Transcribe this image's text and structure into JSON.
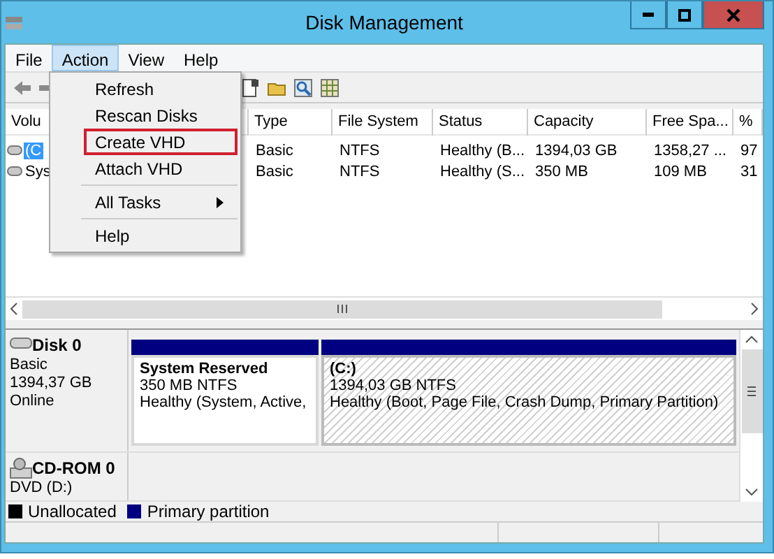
{
  "window": {
    "title": "Disk Management"
  },
  "menubar": [
    {
      "label": "File",
      "selected": false
    },
    {
      "label": "Action",
      "selected": true
    },
    {
      "label": "View",
      "selected": false
    },
    {
      "label": "Help",
      "selected": false
    }
  ],
  "menu": [
    {
      "kind": "item",
      "label": "Refresh",
      "outlined": false
    },
    {
      "kind": "item",
      "label": "Rescan Disks",
      "outlined": false
    },
    {
      "kind": "item",
      "label": "Create VHD",
      "outlined": true
    },
    {
      "kind": "item",
      "label": "Attach VHD",
      "outlined": false
    },
    {
      "kind": "separator"
    },
    {
      "kind": "submenu",
      "label": "All Tasks",
      "outlined": false
    },
    {
      "kind": "separator"
    },
    {
      "kind": "item",
      "label": "Help",
      "outlined": false
    }
  ],
  "table": {
    "columns": [
      "Volu",
      "Type",
      "File System",
      "Status",
      "Capacity",
      "Free Spa...",
      "%"
    ],
    "rows": [
      {
        "selected": true,
        "cells": [
          "(C",
          "Basic",
          "NTFS",
          "Healthy (B...",
          "1394,03 GB",
          "1358,27 ...",
          "97"
        ]
      },
      {
        "selected": false,
        "cells": [
          "Sys",
          "Basic",
          "NTFS",
          "Healthy (S...",
          "350 MB",
          "109 MB",
          "31"
        ]
      }
    ]
  },
  "disks": [
    {
      "name": "Disk 0",
      "kind": "disk",
      "details": [
        "Basic",
        "1394,37 GB",
        "Online"
      ],
      "partitions": [
        {
          "name": "System Reserved",
          "size": "350 MB NTFS",
          "status": "Healthy (System, Active,",
          "selected": false
        },
        {
          "name": "(C:)",
          "size": "1394,03 GB NTFS",
          "status": "Healthy (Boot, Page File, Crash Dump, Primary Partition)",
          "selected": true
        }
      ]
    },
    {
      "name": "CD-ROM 0",
      "kind": "cdrom",
      "details": [
        "DVD (D:)"
      ]
    }
  ],
  "legend": [
    {
      "label": "Unallocated",
      "color": "#000000"
    },
    {
      "label": "Primary partition",
      "color": "#000080"
    }
  ]
}
